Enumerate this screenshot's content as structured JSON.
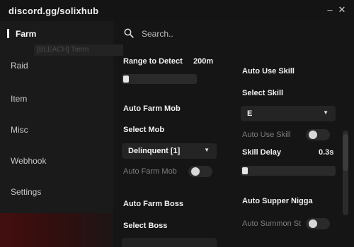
{
  "window": {
    "title": "discord.gg/solixhub"
  },
  "sidebar": {
    "items": [
      {
        "label": "Farm",
        "active": true
      },
      {
        "label": "Raid"
      },
      {
        "label": "Item"
      },
      {
        "label": "Misc"
      },
      {
        "label": "Webhook"
      },
      {
        "label": "Settings"
      }
    ],
    "ghost_text": "[BLEACH] Tierm"
  },
  "search": {
    "placeholder": "Search.."
  },
  "left_column": {
    "range_label": "Range to Detect",
    "range_value": "200m",
    "range_level": 0,
    "auto_farm_mob_header": "Auto Farm Mob",
    "select_mob_label": "Select Mob",
    "select_mob_value": "Delinquent [1]",
    "auto_farm_mob_toggle_label": "Auto Farm Mob",
    "auto_farm_mob_on": false,
    "auto_farm_boss_header": "Auto Farm Boss",
    "select_boss_label": "Select Boss"
  },
  "right_column": {
    "auto_use_skill_header": "Auto Use Skill",
    "select_skill_label": "Select Skill",
    "select_skill_value": "E",
    "auto_use_skill_toggle_label": "Auto Use Skill",
    "auto_use_skill_on": false,
    "skill_delay_label": "Skill Delay",
    "skill_delay_value": "0.3s",
    "skill_delay_level": 0,
    "auto_supper_header": "Auto Supper Nigga",
    "auto_summon_label": "Auto Summon St",
    "auto_summon_on": false
  },
  "icons": {
    "search": "search-icon",
    "minimize": "minimize-icon",
    "close": "close-icon",
    "caret": "chevron-down-icon"
  },
  "colors": {
    "background": "#151515",
    "sidebar": "#1a1a1a",
    "accent": "#ffffff",
    "control": "#242424"
  }
}
